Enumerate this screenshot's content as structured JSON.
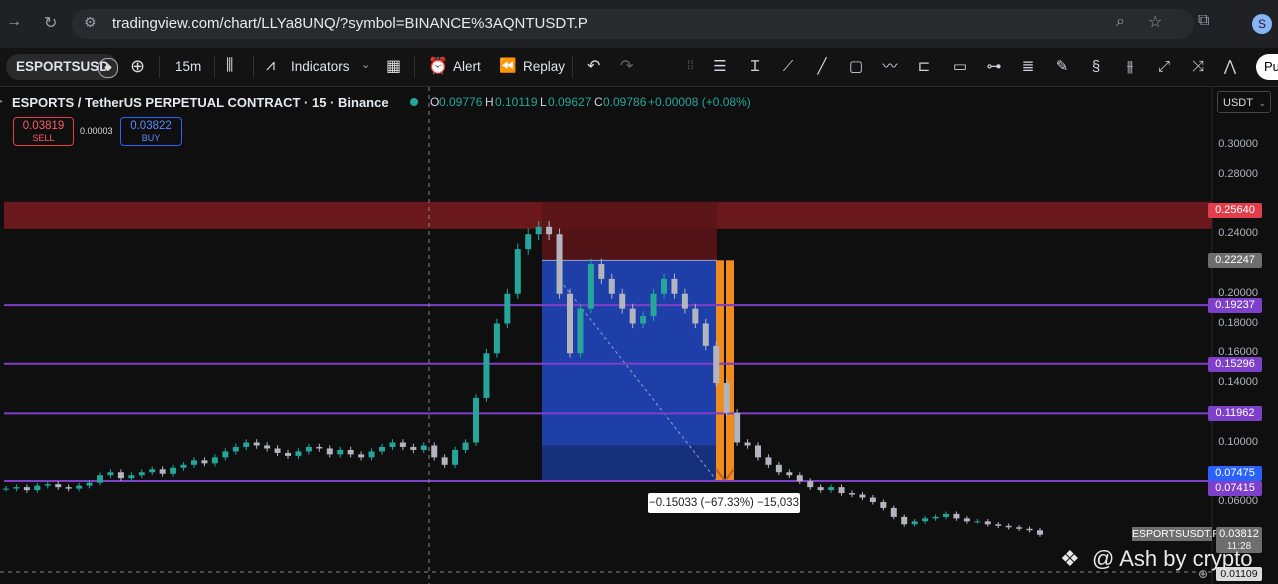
{
  "browser": {
    "url": "tradingview.com/chart/LLYa8UNQ/?symbol=BINANCE%3AQNTUSDT.P",
    "profile_initial": "S"
  },
  "toolbar": {
    "symbol": "ESPORTSUSD",
    "interval": "15m",
    "indicators_label": "Indicators",
    "alert_label": "Alert",
    "replay_label": "Replay",
    "publish_label": "Pu"
  },
  "legend": {
    "title": "ESPORTS / TetherUS PERPETUAL CONTRACT · 15 · Binance",
    "o_label": "O",
    "o_value": "0.09776",
    "h_label": "H",
    "h_value": "0.10119",
    "l_label": "L",
    "l_value": "0.09627",
    "c_label": "C",
    "c_value": "0.09786",
    "change": "+0.00008 (+0.08%)"
  },
  "trade": {
    "sell_price": "0.03819",
    "sell_label": "SELL",
    "spread": "0.00003",
    "buy_price": "0.03822",
    "buy_label": "BUY"
  },
  "currency": "USDT",
  "axis": {
    "ticks": [
      "0.30000",
      "0.28000",
      "0.24000",
      "0.20000",
      "0.18000",
      "0.16000",
      "0.14000",
      "0.10000",
      "0.06000"
    ],
    "tick_values": [
      0.3,
      0.28,
      0.24,
      0.2,
      0.18,
      0.16,
      0.14,
      0.1,
      0.06
    ],
    "tags": [
      {
        "text": "0.25640",
        "value": 0.2564,
        "color": "#e13d4a"
      },
      {
        "text": "0.22247",
        "value": 0.22247,
        "color": "#6e6e6e"
      },
      {
        "text": "0.19237",
        "value": 0.19237,
        "color": "#7e3fc9"
      },
      {
        "text": "0.15296",
        "value": 0.15296,
        "color": "#7e3fc9"
      },
      {
        "text": "0.11962",
        "value": 0.11962,
        "color": "#7e3fc9"
      },
      {
        "text": "0.07475",
        "value": 0.07475,
        "color": "#2962ff"
      },
      {
        "text": "0.07415",
        "value": 0.07415,
        "color": "#7e3fc9"
      }
    ],
    "last_symbol": "ESPORTSUSDT.P",
    "last_price": "0.03812",
    "countdown": "11:28",
    "bottom_price": "0.01109"
  },
  "levels": [
    0.19237,
    0.15296,
    0.11962,
    0.07415
  ],
  "position": {
    "entry": 0.22247,
    "stop": 0.2564,
    "target": 0.07415,
    "pnl_label": "−0.15033 (−67.33%) −15,033"
  },
  "watermark": "@ Ash by crypto",
  "colors": {
    "up": "#26a69a",
    "down": "#b2b5be",
    "level": "#7e3fc9",
    "stop_zone": "#8a1c22",
    "target_zone": "#1e3fa8",
    "bar_orange": "#f08c1e"
  },
  "chart_data": {
    "type": "candlestick",
    "ylim": [
      0.01,
      0.32
    ],
    "close": [
      0.069,
      0.07,
      0.068,
      0.071,
      0.072,
      0.07,
      0.069,
      0.071,
      0.073,
      0.078,
      0.08,
      0.076,
      0.078,
      0.08,
      0.082,
      0.079,
      0.083,
      0.085,
      0.088,
      0.086,
      0.09,
      0.094,
      0.097,
      0.1,
      0.098,
      0.096,
      0.093,
      0.091,
      0.094,
      0.097,
      0.096,
      0.092,
      0.095,
      0.092,
      0.09,
      0.094,
      0.097,
      0.1,
      0.097,
      0.095,
      0.098,
      0.09,
      0.085,
      0.095,
      0.1,
      0.13,
      0.16,
      0.18,
      0.2,
      0.23,
      0.24,
      0.245,
      0.24,
      0.2,
      0.16,
      0.19,
      0.22,
      0.21,
      0.2,
      0.19,
      0.18,
      0.185,
      0.2,
      0.21,
      0.2,
      0.19,
      0.18,
      0.165,
      0.14,
      0.12,
      0.1,
      0.098,
      0.09,
      0.085,
      0.08,
      0.078,
      0.074,
      0.07,
      0.068,
      0.07,
      0.066,
      0.065,
      0.063,
      0.06,
      0.056,
      0.05,
      0.045,
      0.047,
      0.049,
      0.05,
      0.052,
      0.049,
      0.047,
      0.047,
      0.045,
      0.044,
      0.043,
      0.042,
      0.041,
      0.038
    ]
  }
}
